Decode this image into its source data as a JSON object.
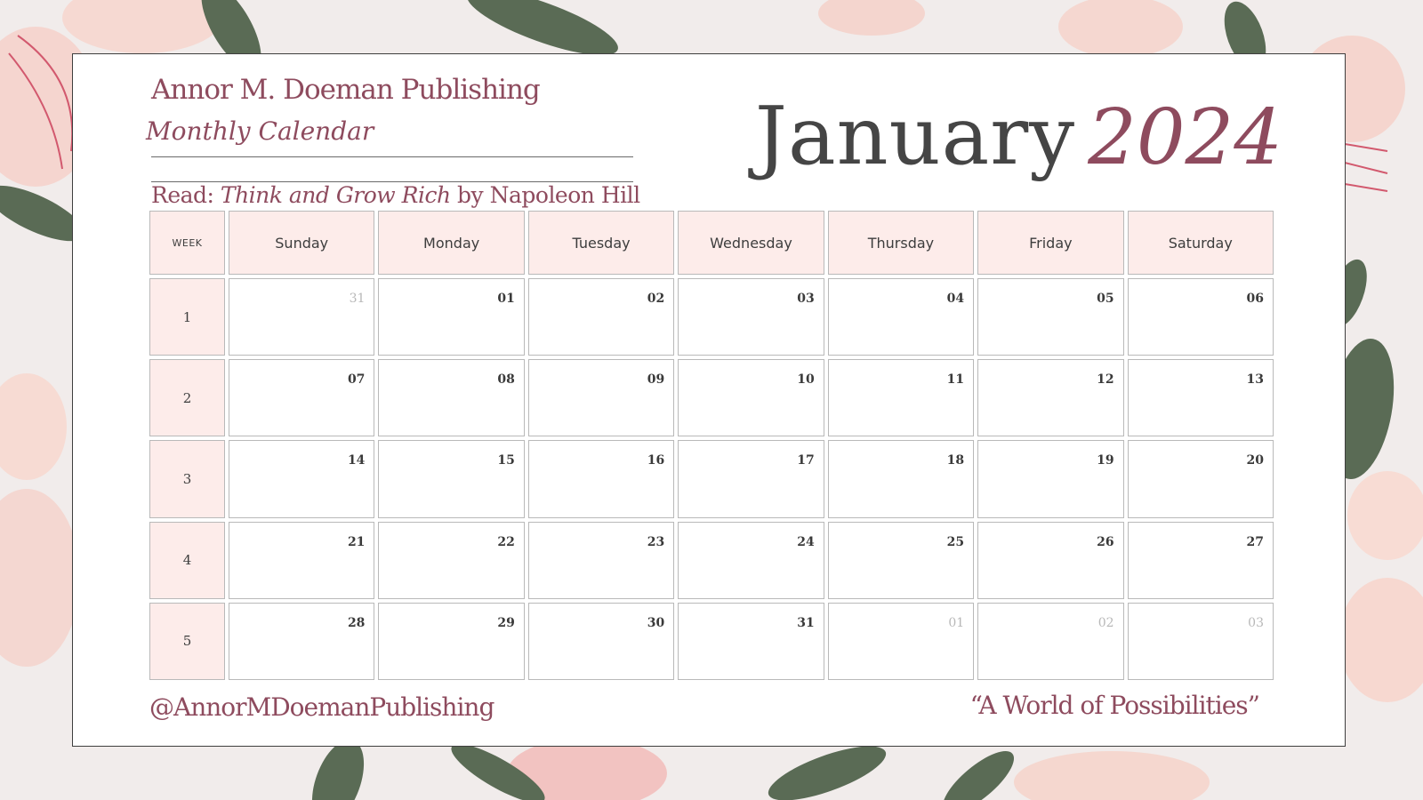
{
  "header": {
    "publisher": "Annor M. Doeman Publishing",
    "subtitle": "Monthly Calendar",
    "read_prefix": "Read:",
    "book_title": "Think and Grow Rich",
    "book_author": "by Napoleon Hill",
    "month": "January",
    "year": "2024"
  },
  "calendar": {
    "week_label": "WEEK",
    "days": [
      "Sunday",
      "Monday",
      "Tuesday",
      "Wednesday",
      "Thursday",
      "Friday",
      "Saturday"
    ],
    "weeks": [
      {
        "week": "1",
        "dates": [
          {
            "d": "31",
            "muted": true
          },
          {
            "d": "01"
          },
          {
            "d": "02"
          },
          {
            "d": "03"
          },
          {
            "d": "04"
          },
          {
            "d": "05"
          },
          {
            "d": "06"
          }
        ]
      },
      {
        "week": "2",
        "dates": [
          {
            "d": "07"
          },
          {
            "d": "08"
          },
          {
            "d": "09"
          },
          {
            "d": "10"
          },
          {
            "d": "11"
          },
          {
            "d": "12"
          },
          {
            "d": "13"
          }
        ]
      },
      {
        "week": "3",
        "dates": [
          {
            "d": "14"
          },
          {
            "d": "15"
          },
          {
            "d": "16"
          },
          {
            "d": "17"
          },
          {
            "d": "18"
          },
          {
            "d": "19"
          },
          {
            "d": "20"
          }
        ]
      },
      {
        "week": "4",
        "dates": [
          {
            "d": "21"
          },
          {
            "d": "22"
          },
          {
            "d": "23"
          },
          {
            "d": "24"
          },
          {
            "d": "25"
          },
          {
            "d": "26"
          },
          {
            "d": "27"
          }
        ]
      },
      {
        "week": "5",
        "dates": [
          {
            "d": "28"
          },
          {
            "d": "29"
          },
          {
            "d": "30"
          },
          {
            "d": "31"
          },
          {
            "d": "01",
            "muted": true
          },
          {
            "d": "02",
            "muted": true
          },
          {
            "d": "03",
            "muted": true
          }
        ]
      }
    ]
  },
  "footer": {
    "handle": "@AnnorMDoemanPublishing",
    "tagline": "“A World of Possibilities”"
  },
  "colors": {
    "accent": "#8e4b5e",
    "header_fill": "#fdecea",
    "background": "#f1eceb"
  }
}
